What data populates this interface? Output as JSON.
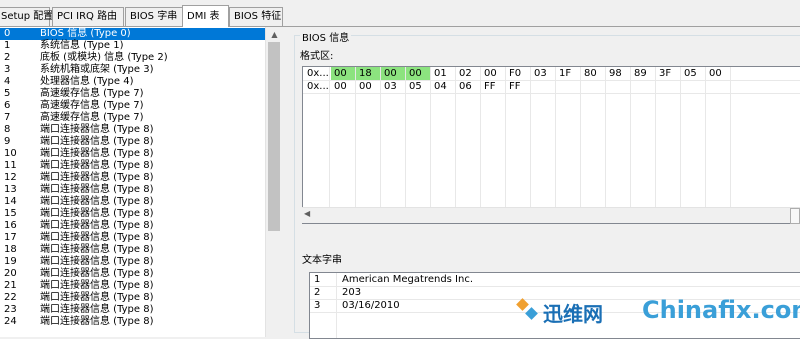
{
  "tabs": [
    {
      "label": "Setup 配置"
    },
    {
      "label": "PCI IRQ 路由"
    },
    {
      "label": "BIOS 字串"
    },
    {
      "label": "DMI 表"
    },
    {
      "label": "BIOS 特征"
    }
  ],
  "dmi_list": [
    {
      "index": "0",
      "name": "BIOS 信息  (Type 0)"
    },
    {
      "index": "1",
      "name": "系统信息  (Type 1)"
    },
    {
      "index": "2",
      "name": "底板 (或模块) 信息  (Type 2)"
    },
    {
      "index": "3",
      "name": "系统机箱或底架  (Type 3)"
    },
    {
      "index": "4",
      "name": "处理器信息  (Type 4)"
    },
    {
      "index": "5",
      "name": "高速缓存信息  (Type 7)"
    },
    {
      "index": "6",
      "name": "高速缓存信息  (Type 7)"
    },
    {
      "index": "7",
      "name": "高速缓存信息  (Type 7)"
    },
    {
      "index": "8",
      "name": "端口连接器信息  (Type 8)"
    },
    {
      "index": "9",
      "name": "端口连接器信息  (Type 8)"
    },
    {
      "index": "10",
      "name": "端口连接器信息  (Type 8)"
    },
    {
      "index": "11",
      "name": "端口连接器信息  (Type 8)"
    },
    {
      "index": "12",
      "name": "端口连接器信息  (Type 8)"
    },
    {
      "index": "13",
      "name": "端口连接器信息  (Type 8)"
    },
    {
      "index": "14",
      "name": "端口连接器信息  (Type 8)"
    },
    {
      "index": "15",
      "name": "端口连接器信息  (Type 8)"
    },
    {
      "index": "16",
      "name": "端口连接器信息  (Type 8)"
    },
    {
      "index": "17",
      "name": "端口连接器信息  (Type 8)"
    },
    {
      "index": "18",
      "name": "端口连接器信息  (Type 8)"
    },
    {
      "index": "19",
      "name": "端口连接器信息  (Type 8)"
    },
    {
      "index": "20",
      "name": "端口连接器信息  (Type 8)"
    },
    {
      "index": "21",
      "name": "端口连接器信息  (Type 8)"
    },
    {
      "index": "22",
      "name": "端口连接器信息  (Type 8)"
    },
    {
      "index": "23",
      "name": "端口连接器信息  (Type 8)"
    },
    {
      "index": "24",
      "name": "端口连接器信息  (Type 8)"
    }
  ],
  "group_title": "BIOS 信息",
  "format_label": "格式区:",
  "hex_rows": [
    {
      "addr": "0x...",
      "bytes": [
        "00",
        "18",
        "00",
        "00",
        "01",
        "02",
        "00",
        "F0",
        "03",
        "1F",
        "80",
        "98",
        "89",
        "3F",
        "05",
        "00"
      ],
      "highlight": [
        0,
        1,
        2,
        3
      ]
    },
    {
      "addr": "0x...",
      "bytes": [
        "00",
        "00",
        "03",
        "05",
        "04",
        "06",
        "FF",
        "FF"
      ],
      "highlight": []
    }
  ],
  "strings_label": "文本字串",
  "strings": [
    {
      "n": "1",
      "text": "American Megatrends Inc."
    },
    {
      "n": "2",
      "text": "203"
    },
    {
      "n": "3",
      "text": "03/16/2010"
    }
  ],
  "watermark": {
    "cn": "迅维网",
    "en": "Chinafix.com"
  },
  "colors": {
    "selection": "#0078d7",
    "hex_highlight": "#8ce37f"
  }
}
